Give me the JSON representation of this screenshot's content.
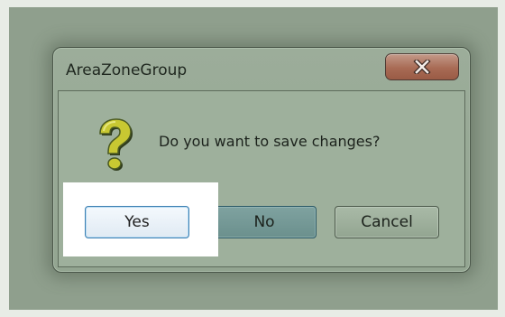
{
  "dialog": {
    "title": "AreaZoneGroup",
    "message": "Do you want to save changes?",
    "icon": "question-icon",
    "close_icon": "close-icon"
  },
  "buttons": {
    "yes": "Yes",
    "no": "No",
    "cancel": "Cancel"
  },
  "colors": {
    "overlay": "#8f9f8d",
    "close_button": "#a86b55",
    "focused_button_border": "#3c7fb1",
    "icon_yellow": "#c8c832"
  }
}
